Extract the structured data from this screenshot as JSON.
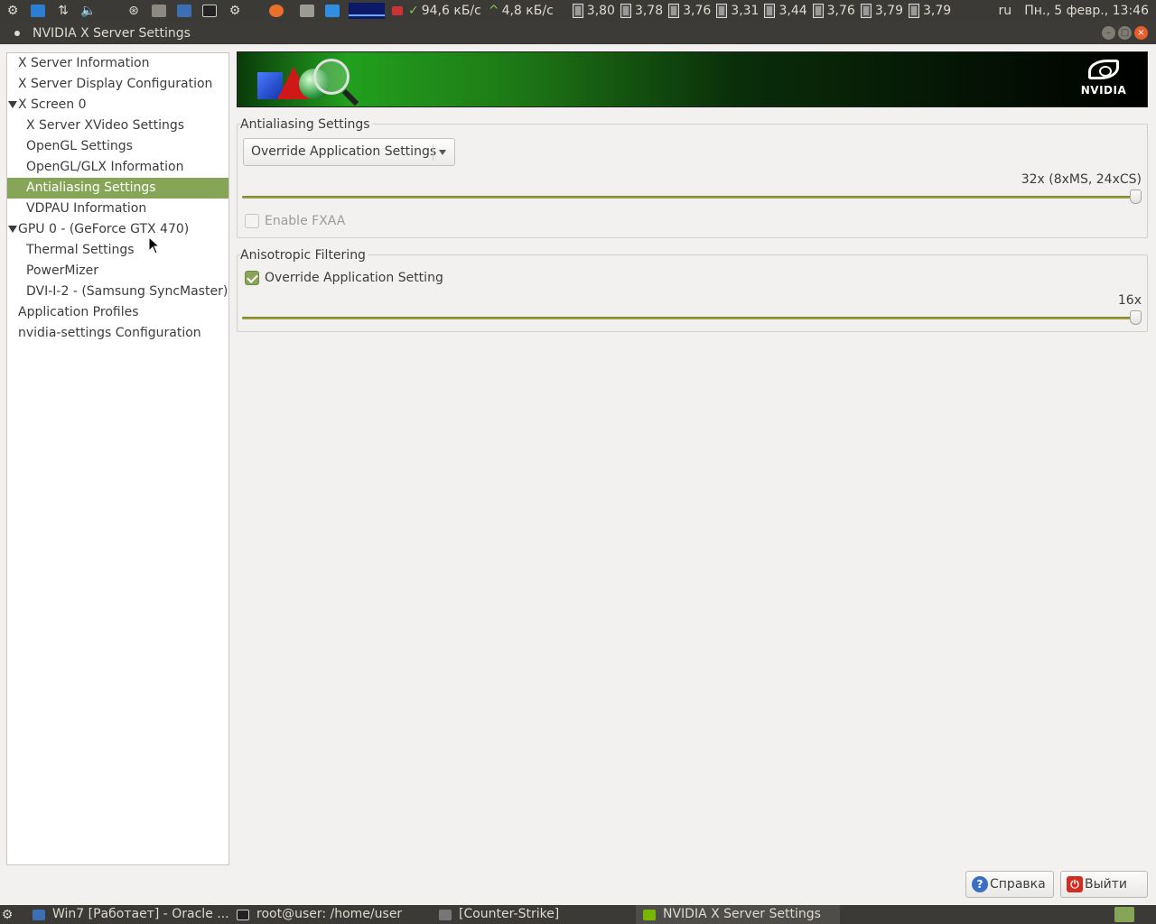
{
  "top_panel": {
    "net_down": "94,6 кБ/с",
    "net_up": "4,8 кБ/с",
    "cpu_freqs": [
      "3,80",
      "3,78",
      "3,76",
      "3,31",
      "3,44",
      "3,76",
      "3,79",
      "3,79"
    ],
    "keyboard_layout": "ru",
    "datetime": "Пн., 5 февр., 13:46"
  },
  "window": {
    "title": "NVIDIA X Server Settings"
  },
  "sidebar": {
    "items": [
      {
        "label": "X Server Information"
      },
      {
        "label": "X Server Display Configuration"
      },
      {
        "label": "X Screen 0"
      },
      {
        "label": "X Server XVideo Settings"
      },
      {
        "label": "OpenGL Settings"
      },
      {
        "label": "OpenGL/GLX Information"
      },
      {
        "label": "Antialiasing Settings"
      },
      {
        "label": "VDPAU Information"
      },
      {
        "label": "GPU 0 - (GeForce GTX 470)"
      },
      {
        "label": "Thermal Settings"
      },
      {
        "label": "PowerMizer"
      },
      {
        "label": "DVI-I-2 - (Samsung SyncMaster)"
      },
      {
        "label": "Application Profiles"
      },
      {
        "label": "nvidia-settings Configuration"
      }
    ],
    "selected_index": 6
  },
  "banner": {
    "logo_text": "NVIDIA"
  },
  "antialiasing": {
    "section_label": "Antialiasing Settings",
    "mode_value": "Override Application Settings",
    "slider_value_text": "32x (8xMS, 24xCS)",
    "slider_level": 1.0,
    "fxaa_label": "Enable FXAA",
    "fxaa_checked": false
  },
  "anisotropic": {
    "section_label": "Anisotropic Filtering",
    "override_label": "Override Application Setting",
    "override_checked": true,
    "slider_value_text": "16x",
    "slider_level": 1.0
  },
  "buttons": {
    "help_label": "Справка",
    "quit_label": "Выйти"
  },
  "taskbar": {
    "tasks": [
      {
        "label": "Win7 [Работает] - Oracle ..."
      },
      {
        "label": "root@user: /home/user"
      },
      {
        "label": "[Counter-Strike]"
      },
      {
        "label": "NVIDIA X Server Settings"
      }
    ]
  },
  "colors": {
    "accent": "#87a556",
    "panel_bg": "#3b3a36",
    "window_bg": "#f2f1f0"
  }
}
